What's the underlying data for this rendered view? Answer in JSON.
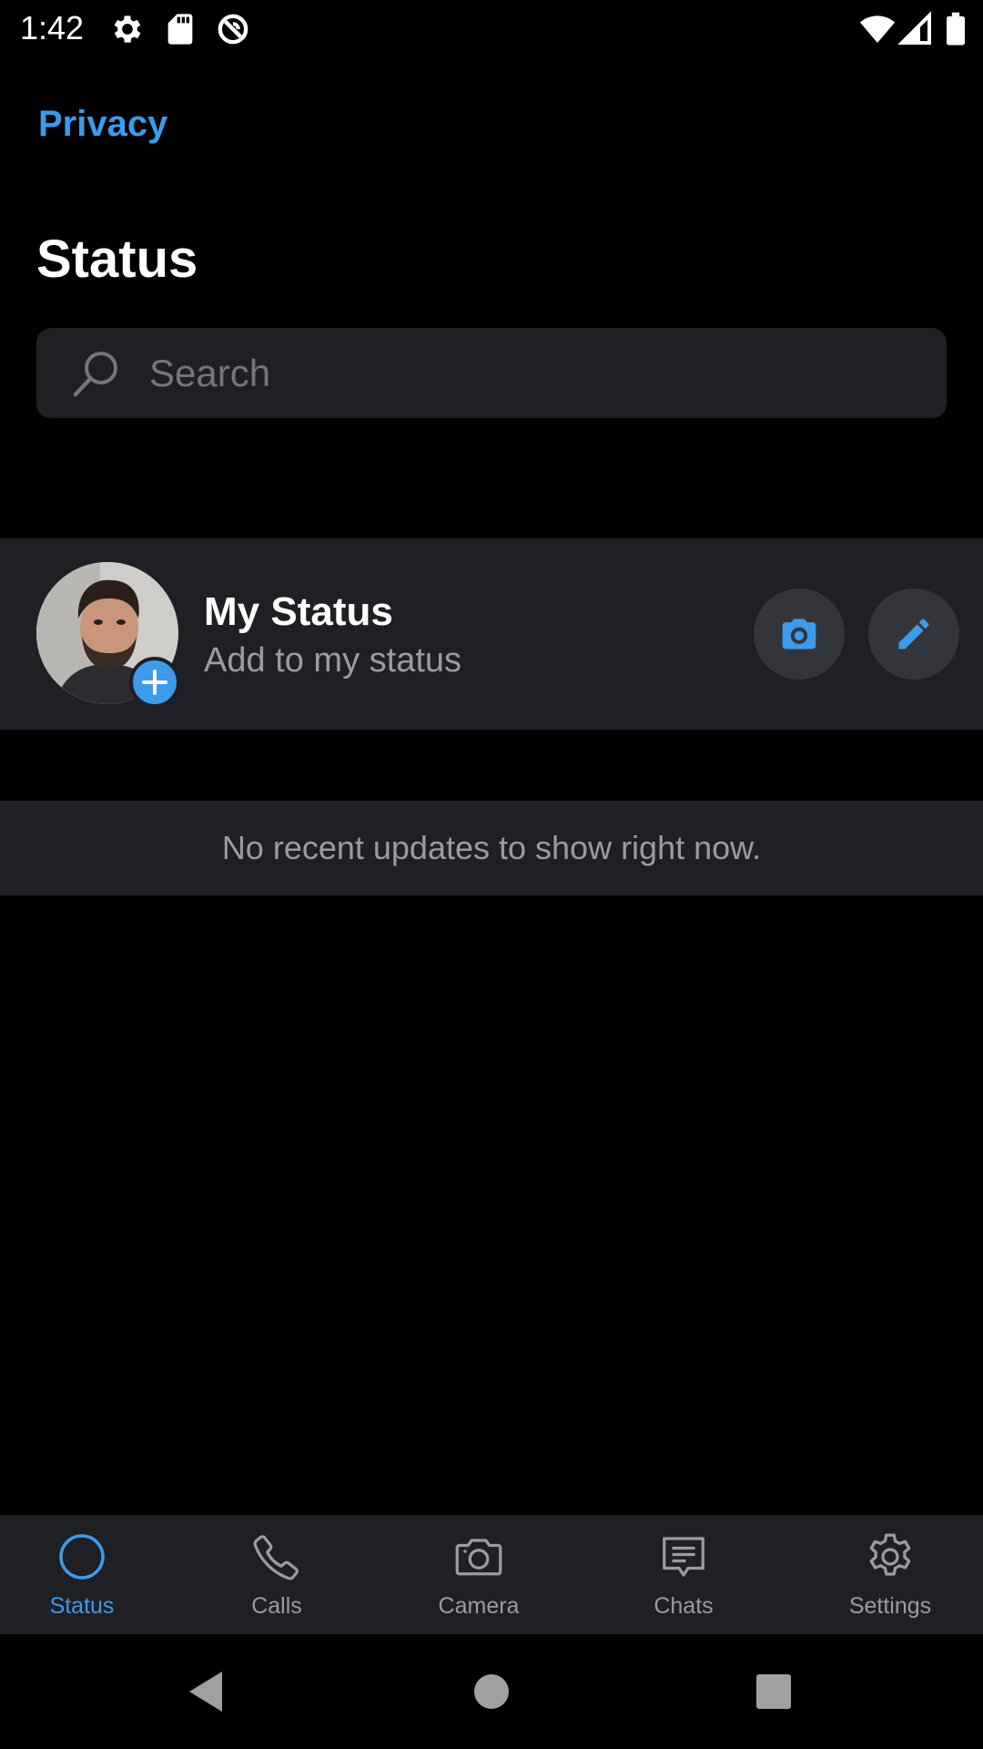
{
  "status_bar": {
    "time": "1:42",
    "left_icons": [
      "gear-icon",
      "sd-card-icon",
      "sync-icon"
    ],
    "right_icons": [
      "wifi-icon",
      "cell-signal-icon",
      "battery-icon"
    ]
  },
  "header": {
    "privacy_label": "Privacy",
    "title": "Status"
  },
  "search": {
    "placeholder": "Search",
    "value": ""
  },
  "my_status": {
    "name": "My Status",
    "subtitle": "Add to my status",
    "actions": [
      "camera-icon",
      "pencil-icon"
    ]
  },
  "updates": {
    "empty_text": "No recent updates to show right now."
  },
  "tabs": [
    {
      "label": "Status",
      "icon": "status-ring-icon",
      "active": true
    },
    {
      "label": "Calls",
      "icon": "phone-icon",
      "active": false
    },
    {
      "label": "Camera",
      "icon": "camera-icon",
      "active": false
    },
    {
      "label": "Chats",
      "icon": "chat-bubble-icon",
      "active": false
    },
    {
      "label": "Settings",
      "icon": "gear-icon",
      "active": false
    }
  ],
  "nav": {
    "buttons": [
      "back-icon",
      "home-icon",
      "recents-icon"
    ]
  },
  "colors": {
    "background": "#000000",
    "surface": "#1f2023",
    "accent": "#3d9be9",
    "muted_text": "#9a9ca1",
    "button_bg": "#34353a"
  }
}
